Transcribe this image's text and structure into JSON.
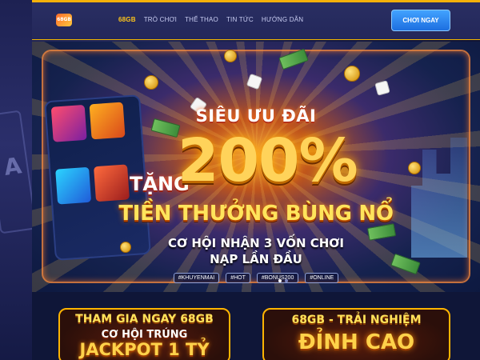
{
  "header": {
    "logo_text": "68GB",
    "nav": [
      {
        "label": "68GB",
        "active": true
      },
      {
        "label": "TRÒ CHƠI",
        "active": false
      },
      {
        "label": "THỂ THAO",
        "active": false
      },
      {
        "label": "TIN TỨC",
        "active": false
      },
      {
        "label": "HƯỚNG DẪN",
        "active": false
      }
    ],
    "cta_label": "CHƠI NGAY"
  },
  "hero": {
    "headline_top": "SIÊU ƯU ĐÃI",
    "tang": "TẶNG",
    "percent": "200%",
    "headline_main": "TIỀN THƯỞNG BÙNG NỔ",
    "sub_line1": "CƠ HỘI NHẬN 3 VỐN CHƠI",
    "sub_line2": "NẠP LẦN ĐẦU",
    "tags": [
      "#KHUYENMAI",
      "#HOT",
      "#BONUS200",
      "#ONLINE"
    ]
  },
  "side_art": {
    "card_symbol": "A"
  },
  "promos": {
    "a": {
      "line1": "THAM GIA NGAY 68GB",
      "line2": "CƠ HỘI TRÚNG",
      "line3": "JACKPOT 1 TỶ"
    },
    "b": {
      "line1": "68GB - TRẢI NGHIỆM",
      "line2": "ĐỈNH CAO"
    }
  },
  "colors": {
    "accent": "#ffc61a",
    "cta": "#2a86f0",
    "bg": "#141843"
  }
}
